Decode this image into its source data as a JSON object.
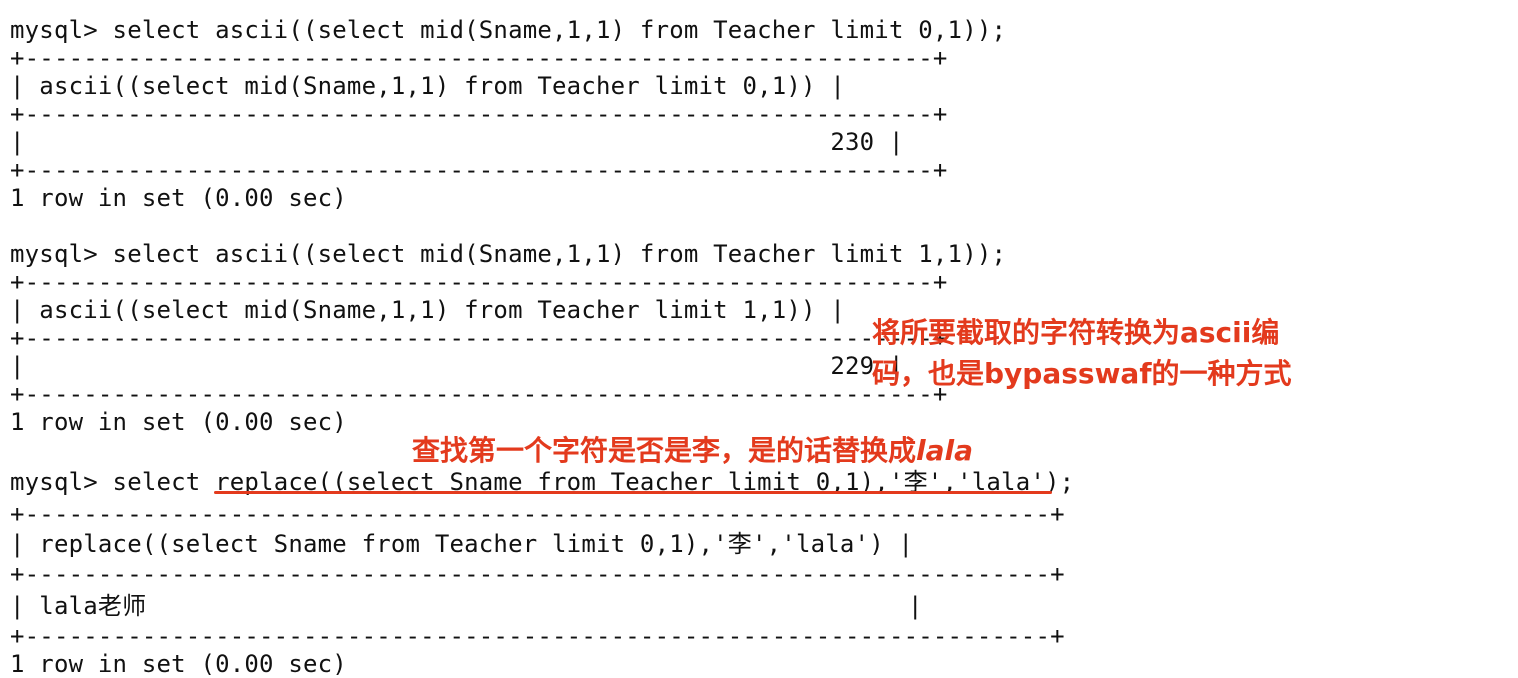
{
  "terminal": {
    "query1": {
      "prompt": "mysql> select ascii((select mid(Sname,1,1) from Teacher limit 0,1));",
      "border": "+--------------------------------------------------------------+",
      "header": "| ascii((select mid(Sname,1,1) from Teacher limit 0,1)) |",
      "value": "|                                                       230 |",
      "footer": "1 row in set (0.00 sec)"
    },
    "query2": {
      "prompt": "mysql> select ascii((select mid(Sname,1,1) from Teacher limit 1,1));",
      "border": "+--------------------------------------------------------------+",
      "header": "| ascii((select mid(Sname,1,1) from Teacher limit 1,1)) |",
      "value": "|                                                       229 |",
      "footer": "1 row in set (0.00 sec)"
    },
    "query3": {
      "prompt_start": "mysql> select ",
      "prompt_highlight": "replace((select Sname from Teacher limit 0,1),'李','lala')",
      "prompt_end": ";",
      "border": "+----------------------------------------------------------------------+",
      "header": "| replace((select Sname from Teacher limit 0,1),'李','lala') |",
      "value": "| lala老师                                                    |",
      "footer": "1 row in set (0.00 sec)"
    }
  },
  "annotations": {
    "ascii_note_line1": "将所要截取的字符转换为ascii编",
    "ascii_note_line2": "码，也是bypasswaf的一种方式",
    "replace_note_prefix": "查找第一个字符是否是李，是的话替换成",
    "replace_note_italic": "lala"
  },
  "colors": {
    "annotation": "#e33a1d",
    "text": "#111111",
    "background": "#ffffff"
  }
}
